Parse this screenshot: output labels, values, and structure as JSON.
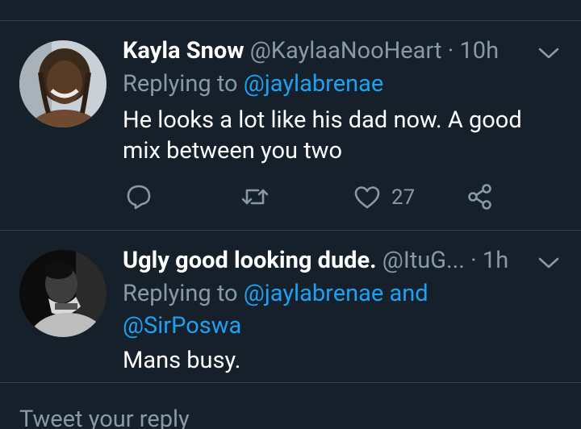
{
  "tweets": [
    {
      "name": "Kayla Snow",
      "handle": "@KaylaaNooHeart",
      "separator": "·",
      "time": "10h",
      "replying_prefix": "Replying to",
      "replying_mentions": [
        "@jaylabrenae"
      ],
      "text": "He looks a lot like his dad now. A good mix between you two",
      "like_count": "27",
      "icons": [
        "reply-icon",
        "retweet-icon",
        "like-icon",
        "share-icon",
        "chevron-down-icon"
      ]
    },
    {
      "name": "Ugly good looking dude.",
      "handle": "@ItuG...",
      "separator": "·",
      "time": "1h",
      "replying_prefix": "Replying to",
      "replying_mentions": [
        "@jaylabrenae",
        "@SirPoswa"
      ],
      "replying_joiner": "and",
      "text": "Mans busy.",
      "icons": [
        "chevron-down-icon"
      ]
    }
  ],
  "composer": {
    "placeholder": "Tweet your reply"
  },
  "colors": {
    "background": "#15202b",
    "divider": "#38444d",
    "secondary_text": "#8899a6",
    "link": "#1da1f2"
  }
}
